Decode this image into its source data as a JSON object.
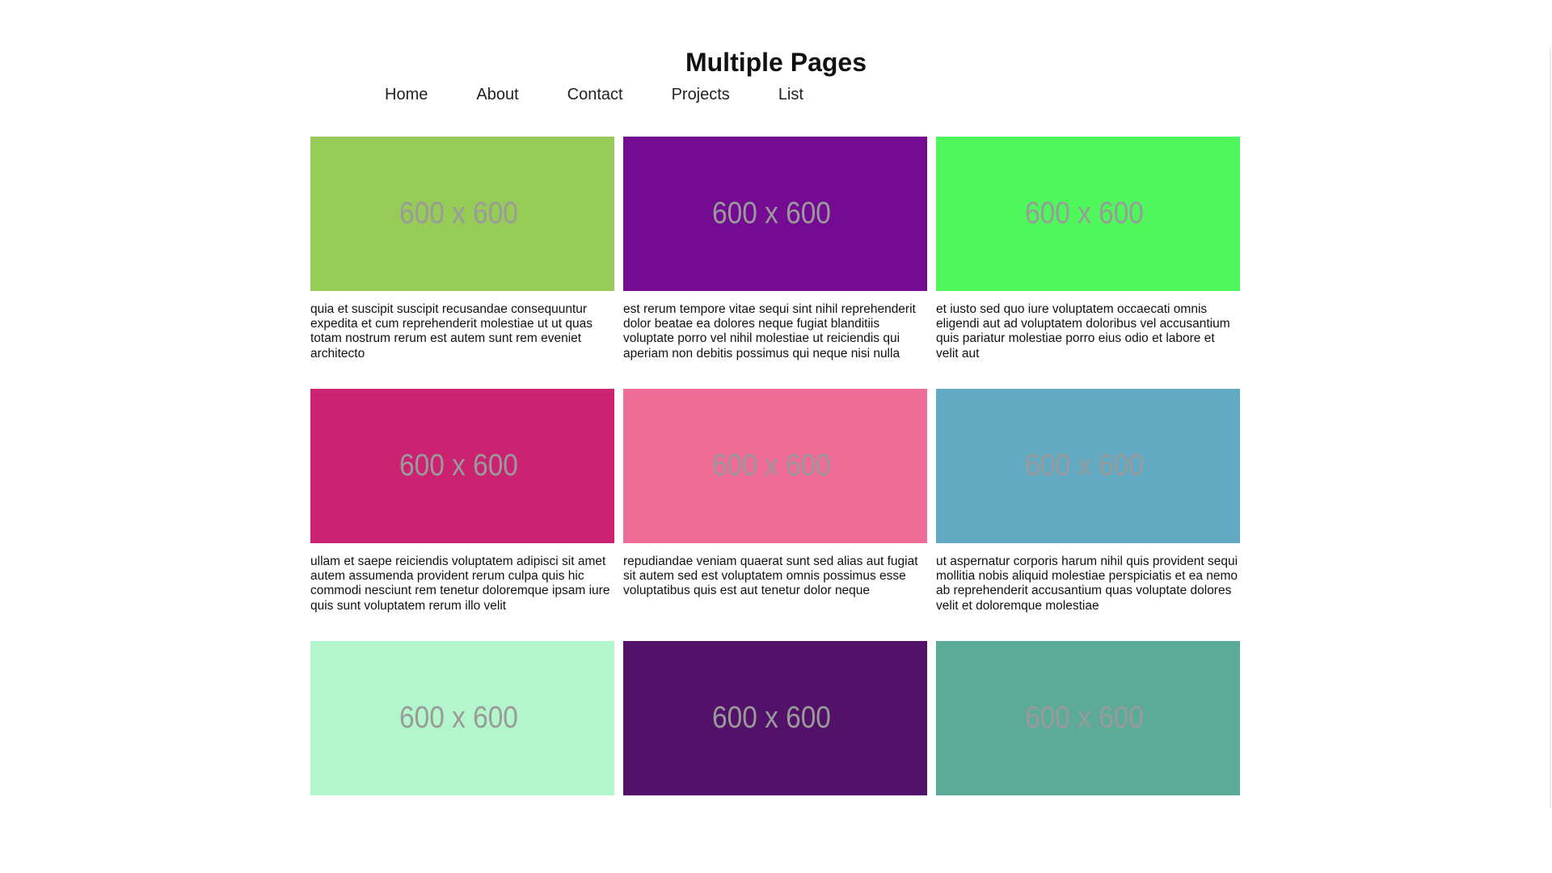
{
  "header": {
    "title": "Multiple Pages"
  },
  "nav": [
    {
      "label": "Home"
    },
    {
      "label": "About"
    },
    {
      "label": "Contact"
    },
    {
      "label": "Projects"
    },
    {
      "label": "List"
    }
  ],
  "cards": [
    {
      "color": "#97cb58",
      "image_label": "600 x 600",
      "text": "quia et suscipit suscipit recusandae consequuntur expedita et cum reprehenderit molestiae ut ut quas totam nostrum rerum est autem sunt rem eveniet architecto"
    },
    {
      "color": "#750a93",
      "image_label": "600 x 600",
      "text": "est rerum tempore vitae sequi sint nihil reprehenderit dolor beatae ea dolores neque fugiat blanditiis voluptate porro vel nihil molestiae ut reiciendis qui aperiam non debitis possimus qui neque nisi nulla"
    },
    {
      "color": "#4ff75d",
      "image_label": "600 x 600",
      "text": "et iusto sed quo iure voluptatem occaecati omnis eligendi aut ad voluptatem doloribus vel accusantium quis pariatur molestiae porro eius odio et labore et velit aut"
    },
    {
      "color": "#cc2272",
      "image_label": "600 x 600",
      "text": "ullam et saepe reiciendis voluptatem adipisci sit amet autem assumenda provident rerum culpa quis hic commodi nesciunt rem tenetur doloremque ipsam iure quis sunt voluptatem rerum illo velit"
    },
    {
      "color": "#ef6c96",
      "image_label": "600 x 600",
      "text": "repudiandae veniam quaerat sunt sed alias aut fugiat sit autem sed est voluptatem omnis possimus esse voluptatibus quis est aut tenetur dolor neque"
    },
    {
      "color": "#62a9c2",
      "image_label": "600 x 600",
      "text": "ut aspernatur corporis harum nihil quis provident sequi mollitia nobis aliquid molestiae perspiciatis et ea nemo ab reprehenderit accusantium quas voluptate dolores velit et doloremque molestiae"
    },
    {
      "color": "#b4f6cc",
      "image_label": "600 x 600",
      "text": ""
    },
    {
      "color": "#521269",
      "image_label": "600 x 600",
      "text": ""
    },
    {
      "color": "#5cab98",
      "image_label": "600 x 600",
      "text": ""
    }
  ]
}
